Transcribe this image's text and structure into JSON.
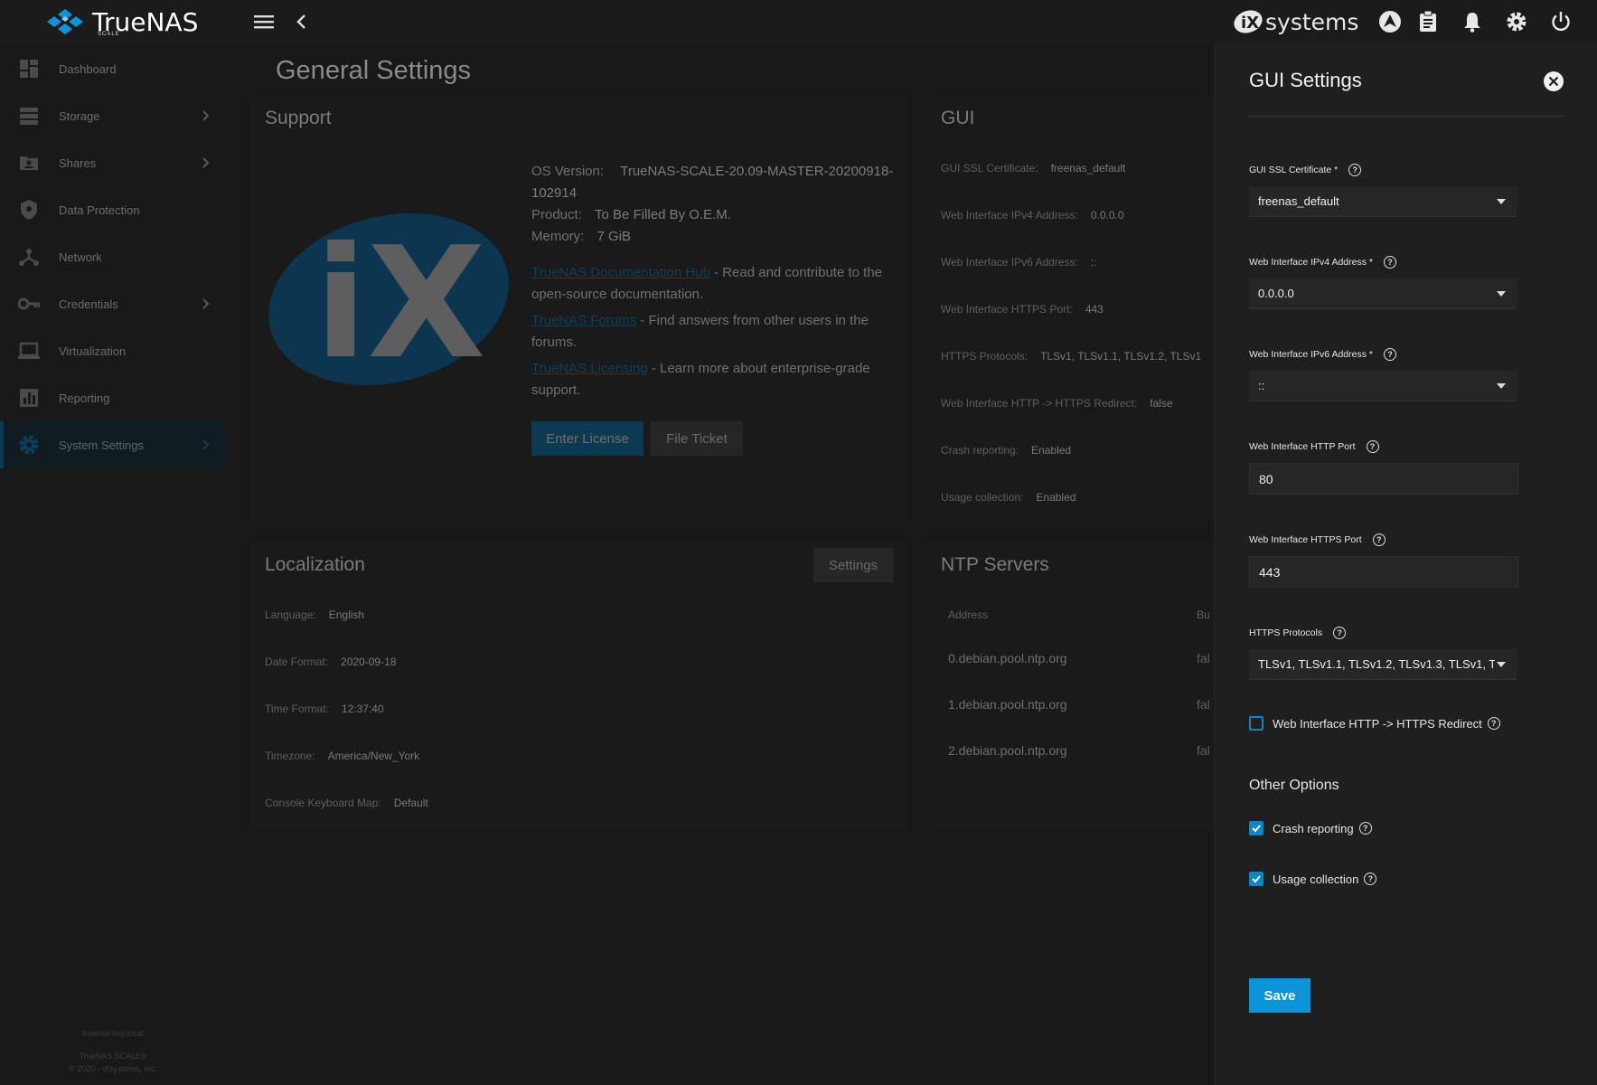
{
  "app": {
    "name": "TrueNAS",
    "edition": "SCALE",
    "vendor": "iXsystems"
  },
  "topbar": {
    "vendor_short": "systems"
  },
  "sidebar": {
    "items": [
      {
        "label": "Dashboard",
        "icon": "dashboard-icon"
      },
      {
        "label": "Storage",
        "icon": "storage-icon"
      },
      {
        "label": "Shares",
        "icon": "shares-icon"
      },
      {
        "label": "Data Protection",
        "icon": "shield-icon"
      },
      {
        "label": "Network",
        "icon": "network-icon"
      },
      {
        "label": "Credentials",
        "icon": "key-icon"
      },
      {
        "label": "Virtualization",
        "icon": "laptop-icon"
      },
      {
        "label": "Reporting",
        "icon": "chart-icon"
      },
      {
        "label": "System Settings",
        "icon": "gear-icon"
      }
    ],
    "footer": {
      "hostname": "truenas-tiny.local",
      "product": "TrueNAS SCALE®",
      "copyright": "© 2020 - iXsystems, Inc."
    }
  },
  "page": {
    "title": "General Settings"
  },
  "support": {
    "title": "Support",
    "os_version_label": "OS Version:",
    "os_version": "TrueNAS-SCALE-20.09-MASTER-20200918-",
    "os_version_2": "102914",
    "product_label": "Product:",
    "product": "To Be Filled By O.E.M.",
    "memory_label": "Memory:",
    "memory": "7 GiB",
    "doc_link": "TrueNAS Documentation Hub",
    "doc_text": " - Read and contribute to the",
    "doc_text2": "open-source documentation.",
    "forums_link": "TrueNAS Forums",
    "forums_text": " - Find answers from other users in the",
    "forums_text2": "forums.",
    "licensing_link": "TrueNAS Licensing",
    "licensing_text": " - Learn more about enterprise-grade",
    "licensing_text2": "support.",
    "enter_license": "Enter License",
    "file_ticket": "File Ticket"
  },
  "gui": {
    "title": "GUI",
    "rows": [
      {
        "label": "GUI SSL Certificate:",
        "value": "freenas_default"
      },
      {
        "label": "Web Interface IPv4 Address:",
        "value": "0.0.0.0"
      },
      {
        "label": "Web Interface IPv6 Address:",
        "value": "::"
      },
      {
        "label": "Web Interface HTTPS Port:",
        "value": "443"
      },
      {
        "label": "HTTPS Protocols:",
        "value": "TLSv1, TLSv1.1, TLSv1.2, TLSv1"
      },
      {
        "label": "Web Interface HTTP -> HTTPS Redirect:",
        "value": "false"
      },
      {
        "label": "Crash reporting:",
        "value": "Enabled"
      },
      {
        "label": "Usage collection:",
        "value": "Enabled"
      }
    ]
  },
  "localization": {
    "title": "Localization",
    "settings_button": "Settings",
    "rows": [
      {
        "label": "Language:",
        "value": "English"
      },
      {
        "label": "Date Format:",
        "value": "2020-09-18"
      },
      {
        "label": "Time Format:",
        "value": "12:37:40"
      },
      {
        "label": "Timezone:",
        "value": "America/New_York"
      },
      {
        "label": "Console Keyboard Map:",
        "value": "Default"
      }
    ]
  },
  "ntp": {
    "title": "NTP Servers",
    "columns": [
      "Address",
      "Bu"
    ],
    "rows": [
      {
        "address": "0.debian.pool.ntp.org",
        "burst": "fal"
      },
      {
        "address": "1.debian.pool.ntp.org",
        "burst": "fal"
      },
      {
        "address": "2.debian.pool.ntp.org",
        "burst": "fal"
      }
    ]
  },
  "panel": {
    "title": "GUI Settings",
    "ssl_label": "GUI SSL Certificate *",
    "ssl_value": "freenas_default",
    "ipv4_label": "Web Interface IPv4 Address *",
    "ipv4_value": "0.0.0.0",
    "ipv6_label": "Web Interface IPv6 Address *",
    "ipv6_value": "::",
    "http_port_label": "Web Interface HTTP Port",
    "http_port_value": "80",
    "https_port_label": "Web Interface HTTPS Port",
    "https_port_value": "443",
    "protocols_label": "HTTPS Protocols",
    "protocols_value": "TLSv1, TLSv1.1, TLSv1.2, TLSv1.3, TLSv1, T...",
    "redirect_label": "Web Interface HTTP -> HTTPS Redirect",
    "redirect_checked": false,
    "other_options": "Other Options",
    "crash_label": "Crash reporting",
    "crash_checked": true,
    "usage_label": "Usage collection",
    "usage_checked": true,
    "save": "Save"
  },
  "colors": {
    "accent": "#0a95d8",
    "panel_bg": "#1f1f1f",
    "page_bg": "#181818"
  }
}
